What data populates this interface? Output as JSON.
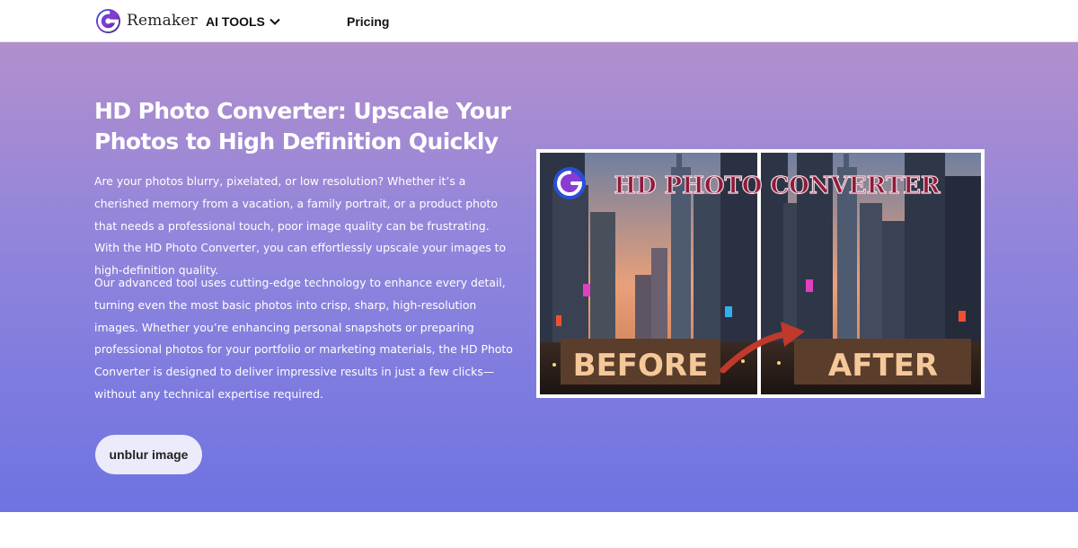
{
  "header": {
    "brand": "Remaker",
    "nav_ai_tools": "AI TOOLS",
    "nav_pricing": "Pricing",
    "icons": [
      "remaker-logo-icon",
      "chevron-down-icon"
    ]
  },
  "hero": {
    "title": "HD Photo Converter: Upscale Your Photos to High Definition Quickly",
    "paragraph1": "Are your photos blurry, pixelated, or low resolution? Whether it’s a cherished memory from a vacation, a family portrait, or a product photo that needs a professional touch, poor image quality can be frustrating. With the HD Photo Converter, you can effortlessly upscale your images to high-definition quality.",
    "paragraph2": "Our advanced tool uses cutting-edge technology to enhance every detail, turning even the most basic photos into crisp, sharp, high-resolution images. Whether you’re enhancing personal snapshots or preparing professional photos for your portfolio or marketing materials, the HD Photo Converter is designed to deliver impressive results in just a few clicks—without any technical expertise required.",
    "cta_label": "unblur image"
  },
  "illustration": {
    "heading": "HD PHOTO CONVERTER",
    "before_label": "BEFORE",
    "after_label": "AFTER"
  },
  "colors": {
    "gradient_top": "#b28fcd",
    "gradient_bottom": "#6e73e2",
    "label_box": "#5a3e2b",
    "label_text": "#f5c89a",
    "arrow": "#c0392b",
    "heading_text": "#8e1b3a"
  }
}
